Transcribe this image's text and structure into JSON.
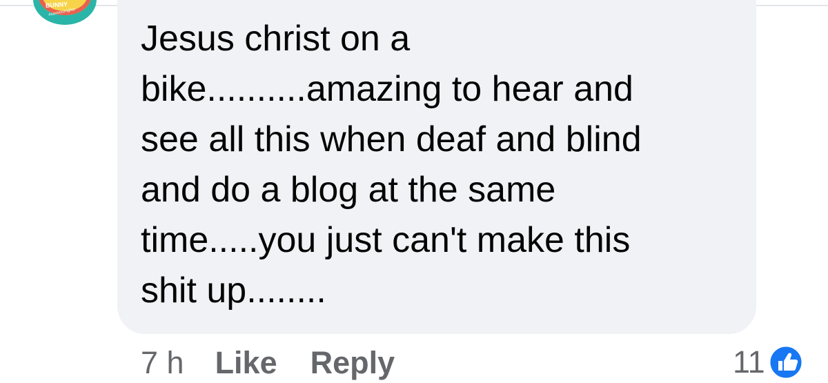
{
  "avatar": {
    "badge_text": "BUNNY",
    "sub_text": "#saveourrights"
  },
  "comment": {
    "lines": [
      "Jesus christ on a",
      "bike..........amazing to hear and",
      "see all this when deaf and blind",
      "and do a blog at the same",
      "time.....you just can't make this",
      "shit up........"
    ]
  },
  "actions": {
    "timestamp": "7 h",
    "like_label": "Like",
    "reply_label": "Reply"
  },
  "reactions": {
    "count": "11",
    "icon": "like-thumb-icon"
  },
  "colors": {
    "bubble": "#f0f2f5",
    "text": "#050505",
    "secondary_text": "#65676b",
    "like_blue": "#1877f2"
  }
}
